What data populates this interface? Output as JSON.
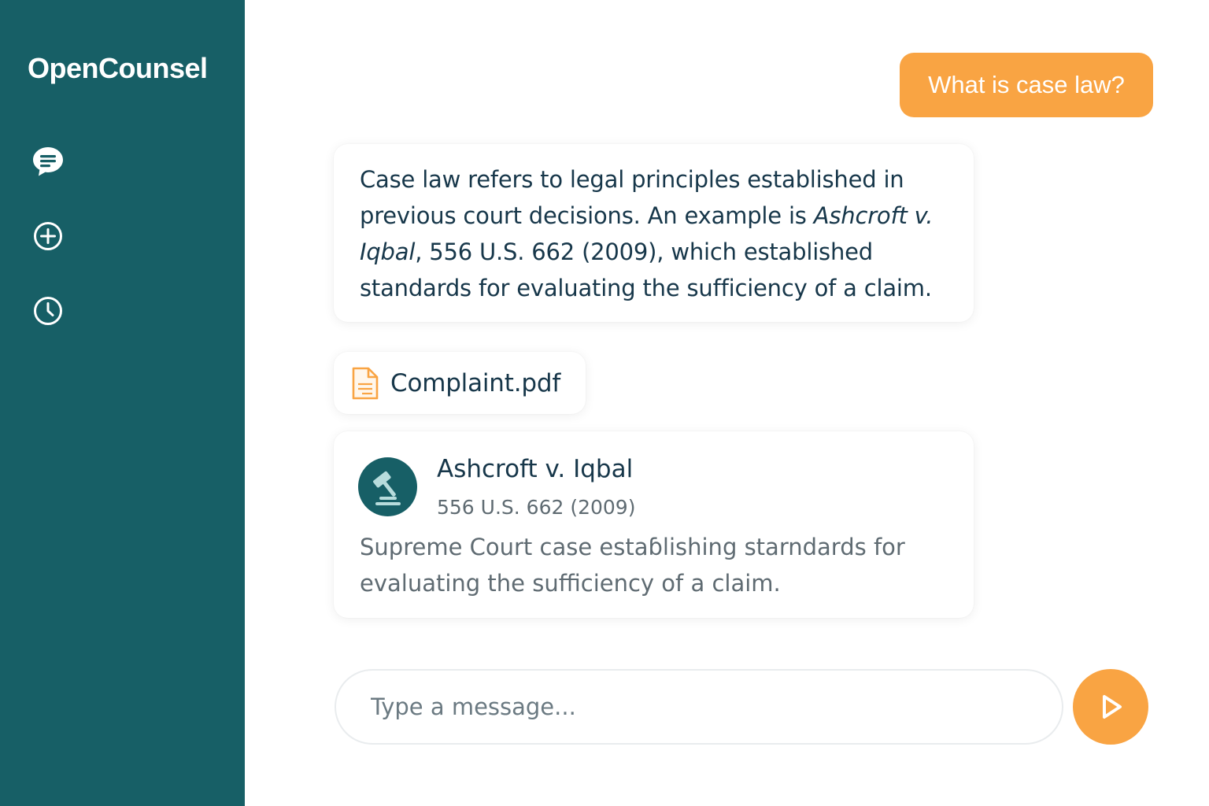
{
  "app": {
    "title": "OpenCounsel"
  },
  "sidebar": {
    "items": [
      {
        "icon": "chat-icon"
      },
      {
        "icon": "plus-circle-icon"
      },
      {
        "icon": "clock-icon"
      }
    ]
  },
  "conversation": {
    "user_message": "What is case law?",
    "assistant_message": {
      "part1": "Case law refers to legal principles established in previous court decisions. An example is ",
      "case_name": "Ashcroft v. Iqbal",
      "part2": ", 556 U.S. 662 (2009), which established standards for evaluating the sufficiency of a claim."
    },
    "attachment": {
      "file_name": "Complaint.pdf",
      "icon": "document-icon"
    },
    "case_card": {
      "icon": "gavel-icon",
      "title": "Ashcroft v. Iqbal",
      "citation": "556 U.S. 662 (2009)",
      "description": "Supreme Court case estaɓlishing starndards for evaluating the sufficiency of a claim."
    }
  },
  "composer": {
    "placeholder": "Type a message...",
    "send_icon": "send-icon"
  },
  "colors": {
    "sidebar": "#175f66",
    "accent": "#f9a443",
    "text": "#17374a",
    "muted": "#5f6b72"
  }
}
